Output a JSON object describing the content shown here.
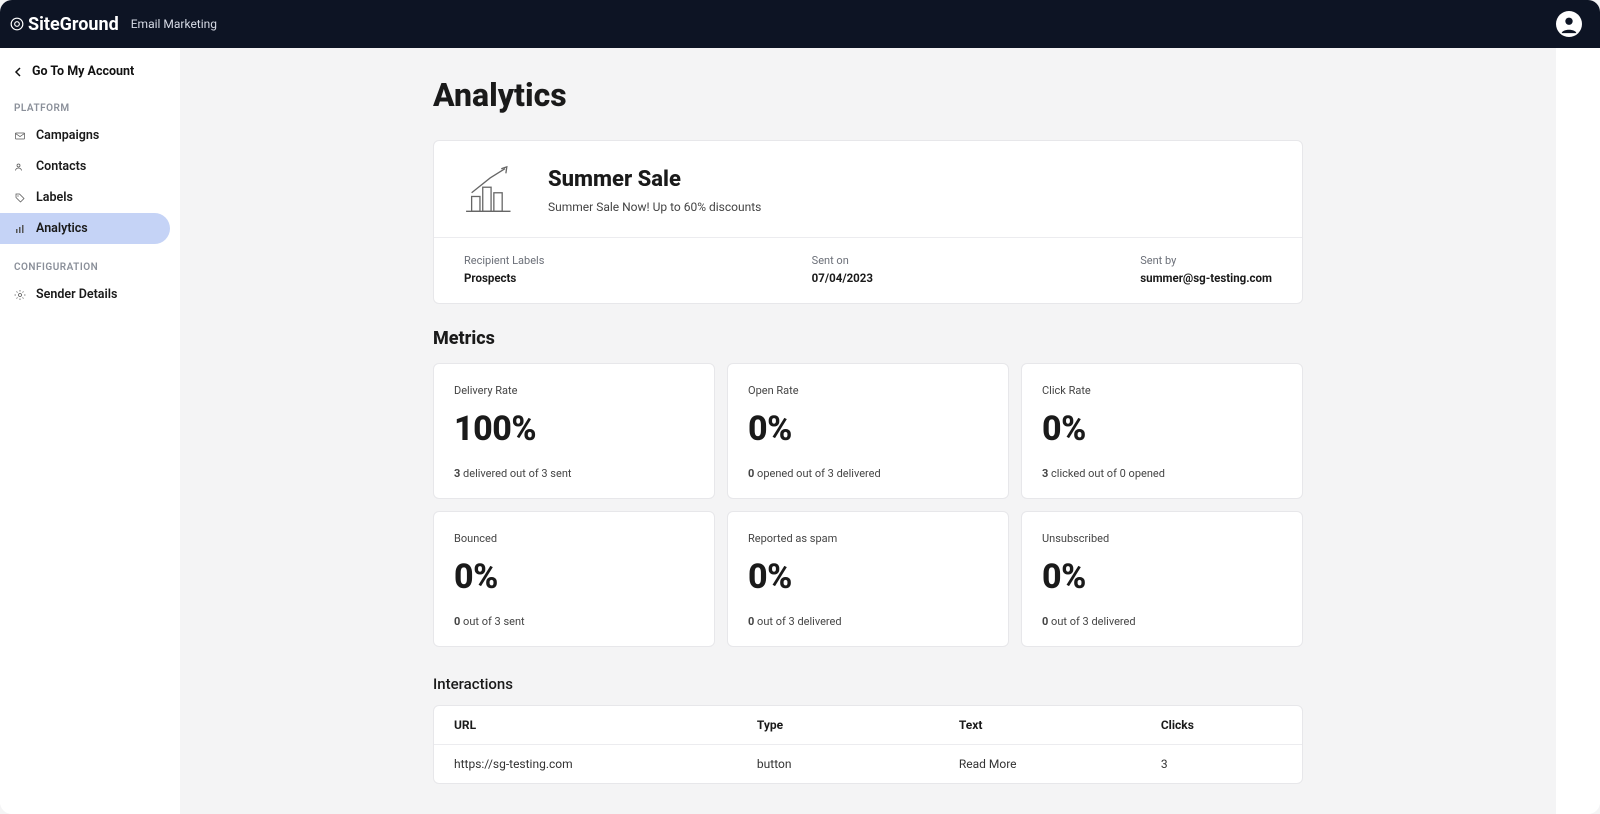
{
  "header": {
    "brand": "SiteGround",
    "app": "Email Marketing"
  },
  "sidebar": {
    "back": "Go To My Account",
    "section_platform": "PLATFORM",
    "section_config": "CONFIGURATION",
    "items": {
      "campaigns": "Campaigns",
      "contacts": "Contacts",
      "labels": "Labels",
      "analytics": "Analytics",
      "sender": "Sender Details"
    }
  },
  "page": {
    "title": "Analytics"
  },
  "campaign": {
    "title": "Summer Sale",
    "subtitle": "Summer Sale Now! Up to 60% discounts",
    "meta": {
      "recipient_label_h": "Recipient Labels",
      "recipient_label_v": "Prospects",
      "sent_on_h": "Sent on",
      "sent_on_v": "07/04/2023",
      "sent_by_h": "Sent by",
      "sent_by_v": "summer@sg-testing.com"
    }
  },
  "metrics_heading": "Metrics",
  "metrics": [
    {
      "label": "Delivery Rate",
      "value": "100%",
      "foot_bold": "3",
      "foot_rest": " delivered out of 3 sent"
    },
    {
      "label": "Open Rate",
      "value": "0%",
      "foot_bold": "0",
      "foot_rest": " opened out of 3 delivered"
    },
    {
      "label": "Click Rate",
      "value": "0%",
      "foot_bold": "3",
      "foot_rest": " clicked out of 0 opened"
    },
    {
      "label": "Bounced",
      "value": "0%",
      "foot_bold": "0",
      "foot_rest": " out of 3 sent"
    },
    {
      "label": "Reported as spam",
      "value": "0%",
      "foot_bold": "0",
      "foot_rest": " out of 3 delivered"
    },
    {
      "label": "Unsubscribed",
      "value": "0%",
      "foot_bold": "0",
      "foot_rest": " out of 3 delivered"
    }
  ],
  "interactions": {
    "heading": "Interactions",
    "columns": {
      "url": "URL",
      "type": "Type",
      "text": "Text",
      "clicks": "Clicks"
    },
    "rows": [
      {
        "url": "https://sg-testing.com",
        "type": "button",
        "text": "Read More",
        "clicks": "3"
      }
    ]
  }
}
